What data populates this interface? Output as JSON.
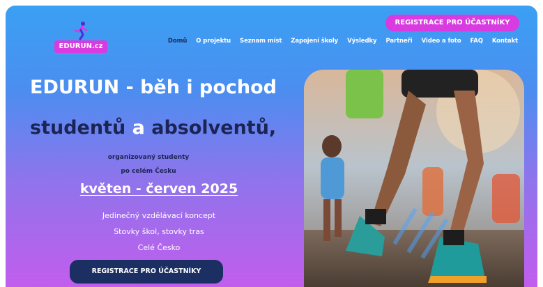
{
  "logo": {
    "text": "EDURUN.cz"
  },
  "header": {
    "cta_label": "REGISTRACE PRO ÚČASTNÍKY"
  },
  "nav": {
    "items": [
      "Domů",
      "O projektu",
      "Seznam míst",
      "Zapojení školy",
      "Výsledky",
      "Partneři",
      "Video a foto",
      "FAQ",
      "Kontakt"
    ],
    "active_index": 0
  },
  "hero": {
    "title_line1": "EDURUN - běh i pochod",
    "title_line2_part1": "studentů",
    "title_line2_highlight": "a",
    "title_line2_part2": "absolventů,",
    "subtitle_line1": "organizovaný studenty",
    "subtitle_line2": "po celém Česku",
    "date": "květen - červen 2025",
    "tagline1": "Jedinečný vzdělávací koncept",
    "tagline2": "Stovky škol, stovky tras",
    "tagline3": "Celé Česko",
    "cta_label": "REGISTRACE PRO ÚČASTNÍKY"
  },
  "colors": {
    "accent": "#d83be0",
    "navy": "#1c2455",
    "gradient_top": "#3aa0f3",
    "gradient_bottom": "#c25ded"
  }
}
